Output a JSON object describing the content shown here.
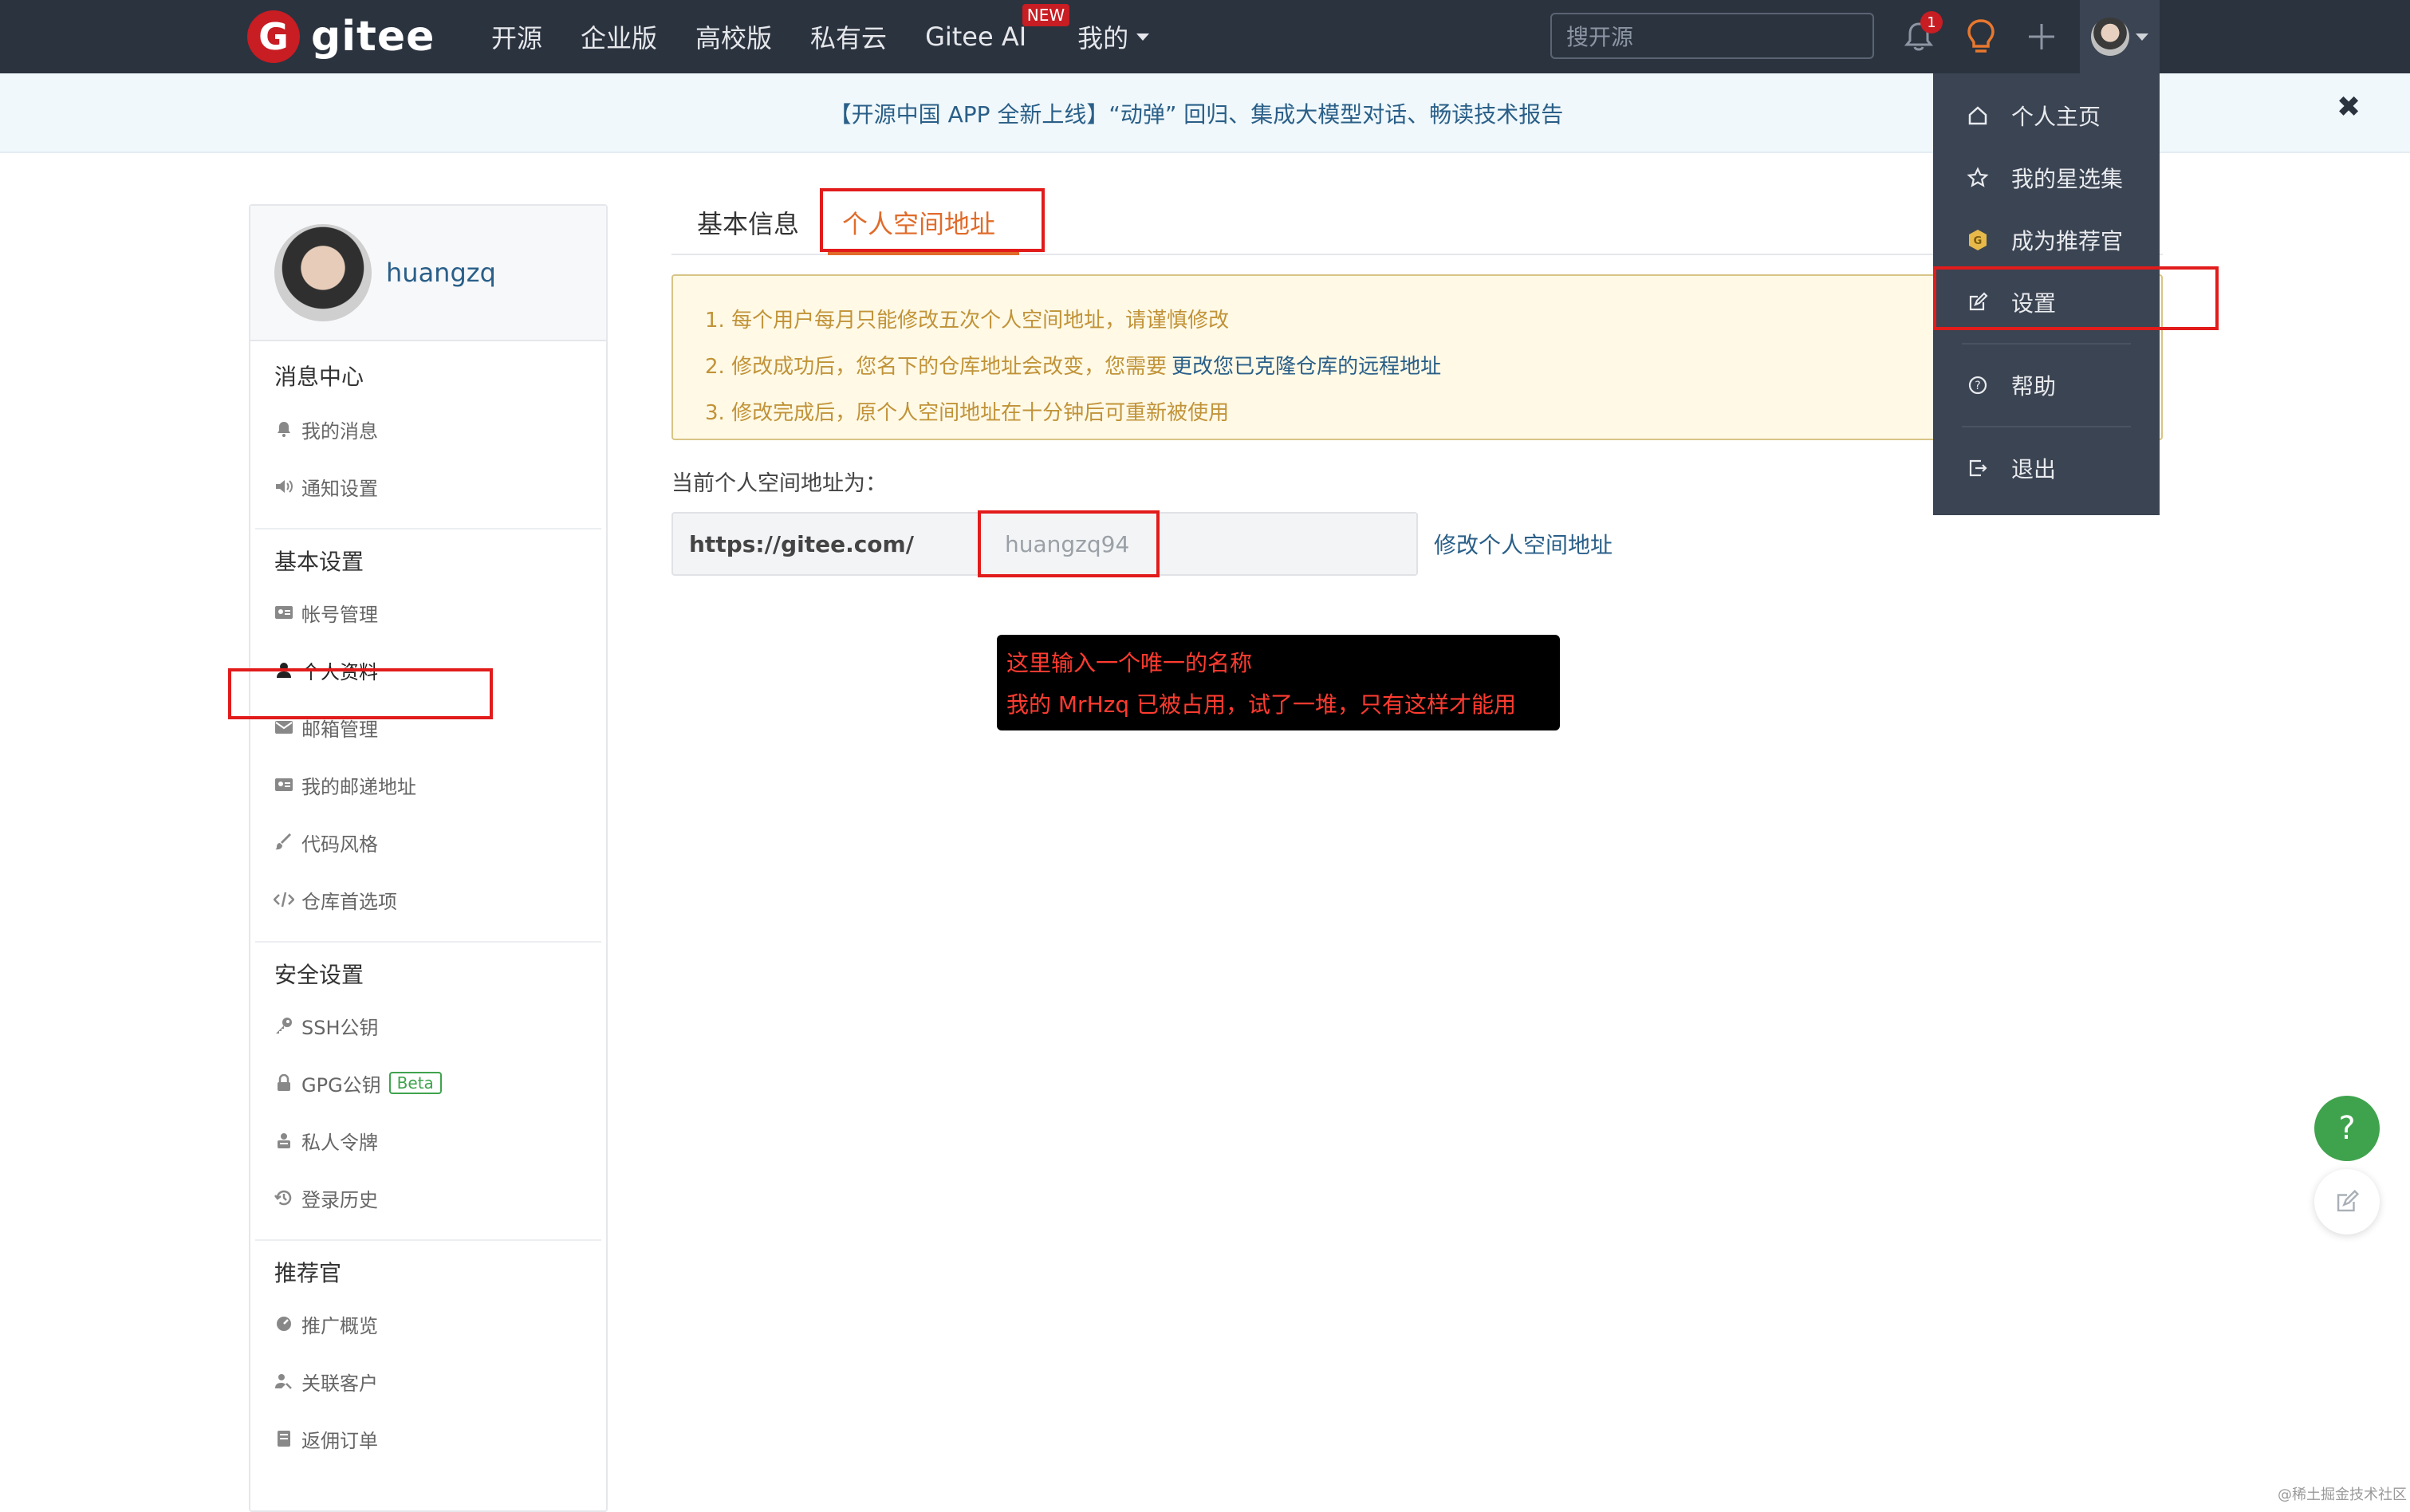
{
  "header": {
    "logo_text": "gitee",
    "logo_mark": "G",
    "nav": [
      "开源",
      "企业版",
      "高校版",
      "私有云",
      "Gitee AI",
      "我的"
    ],
    "new_badge": "NEW",
    "search_placeholder": "搜开源",
    "notification_count": "1"
  },
  "announcement": {
    "text": "【开源中国 APP 全新上线】“动弹” 回归、集成大模型对话、畅读技术报告",
    "close": "✖"
  },
  "sidebar": {
    "username": "huangzq",
    "sections": [
      {
        "title": "消息中心",
        "items": [
          {
            "label": "我的消息",
            "icon": "bell-icon"
          },
          {
            "label": "通知设置",
            "icon": "speaker-icon"
          }
        ]
      },
      {
        "title": "基本设置",
        "items": [
          {
            "label": "帐号管理",
            "icon": "id-card-icon"
          },
          {
            "label": "个人资料",
            "icon": "user-icon"
          },
          {
            "label": "邮箱管理",
            "icon": "envelope-icon"
          },
          {
            "label": "我的邮递地址",
            "icon": "id-card-icon"
          },
          {
            "label": "代码风格",
            "icon": "brush-icon"
          },
          {
            "label": "仓库首选项",
            "icon": "code-icon"
          }
        ]
      },
      {
        "title": "安全设置",
        "items": [
          {
            "label": "SSH公钥",
            "icon": "key-icon"
          },
          {
            "label": "GPG公钥",
            "icon": "lock-icon",
            "badge": "Beta"
          },
          {
            "label": "私人令牌",
            "icon": "token-icon"
          },
          {
            "label": "登录历史",
            "icon": "history-icon"
          }
        ]
      },
      {
        "title": "推荐官",
        "items": [
          {
            "label": "推广概览",
            "icon": "chart-icon"
          },
          {
            "label": "关联客户",
            "icon": "user-link-icon"
          },
          {
            "label": "返佣订单",
            "icon": "order-icon"
          }
        ]
      }
    ]
  },
  "main": {
    "tabs": [
      "基本信息",
      "个人空间地址"
    ],
    "notice": {
      "line1": "1. 每个用户每月只能修改五次个人空间地址，请谨慎修改",
      "line2_prefix": "2. 修改成功后，您名下的仓库地址会改变，您需要",
      "line2_link": "更改您已克隆仓库的远程地址",
      "line3": "3. 修改完成后，原个人空间地址在十分钟后可重新被使用"
    },
    "current_label": "当前个人空间地址为：",
    "url_prefix": "https://gitee.com/",
    "space_value": "huangzq94",
    "modify_link": "修改个人空间地址",
    "annotation": {
      "line1": "这里输入一个唯一的名称",
      "line2": "我的 MrHzq 已被占用，试了一堆，只有这样才能用"
    }
  },
  "dropdown": {
    "items": [
      "个人主页",
      "我的星选集",
      "成为推荐官",
      "设置",
      "帮助",
      "退出"
    ]
  },
  "fab": {
    "help": "?"
  },
  "watermark": "@稀土掘金技术社区",
  "colors": {
    "accent": "#e06b2a",
    "highlight": "#e21b1b",
    "topbar": "#2b333f",
    "link": "#2a5f88"
  }
}
